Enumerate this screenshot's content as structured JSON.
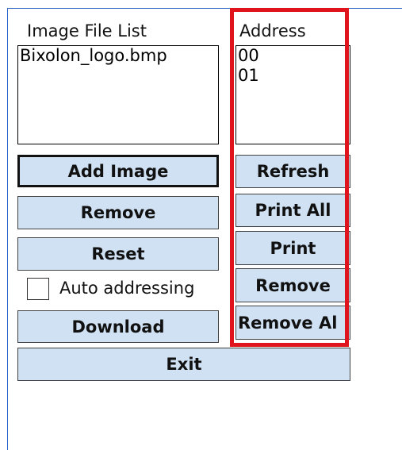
{
  "image_file_list": {
    "label": "Image File List",
    "items": [
      "Bixolon_logo.bmp"
    ]
  },
  "address": {
    "label": "Address",
    "items": [
      "00",
      "01"
    ]
  },
  "left_buttons": {
    "add_image": "Add Image",
    "remove": "Remove",
    "reset": "Reset",
    "download": "Download"
  },
  "auto_addressing": {
    "label": "Auto addressing",
    "checked": false
  },
  "right_buttons": {
    "refresh": "Refresh",
    "print_all": "Print All",
    "print": "Print",
    "remove": "Remove",
    "remove_all": "Remove Al"
  },
  "exit_label": "Exit",
  "colors": {
    "button_face": "#cfe1f3",
    "highlight_border": "#e0141c",
    "window_accent": "#2b63c7"
  }
}
